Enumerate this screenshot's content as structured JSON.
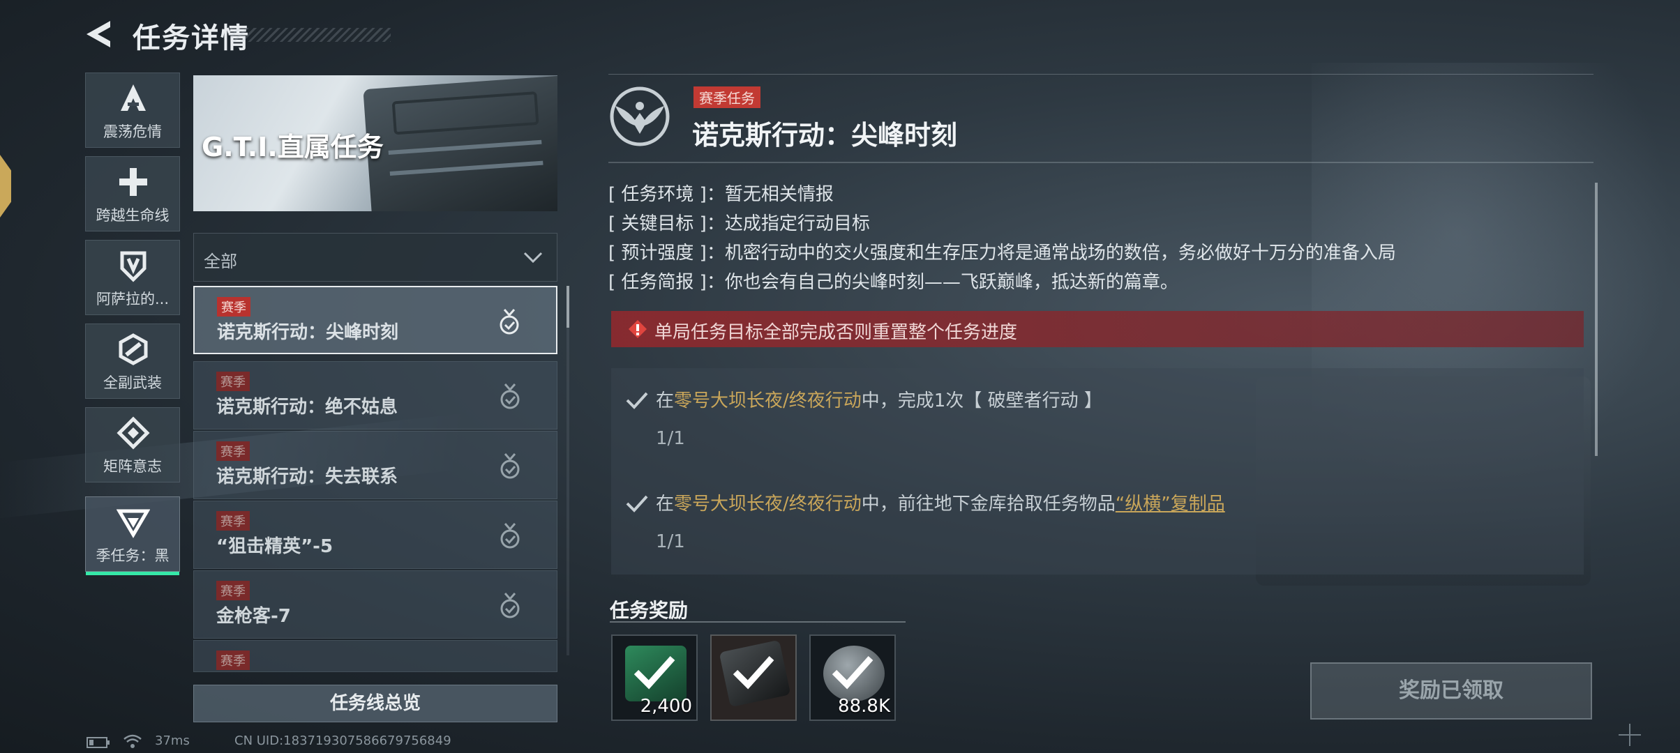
{
  "header": {
    "title": "任务详情"
  },
  "categories": [
    {
      "label": "震荡危情",
      "icon": "triangle-a-icon"
    },
    {
      "label": "跨越生命线",
      "icon": "cross-icon"
    },
    {
      "label": "阿萨拉的...",
      "icon": "shield-v-icon"
    },
    {
      "label": "全副武装",
      "icon": "hex-link-icon"
    },
    {
      "label": "矩阵意志",
      "icon": "diamond-arrows-icon"
    },
    {
      "label": "季任务：黑",
      "icon": "g-chevron-icon",
      "active": true
    }
  ],
  "banner": {
    "title": "G.T.I.直属任务"
  },
  "filter": {
    "value": "全部"
  },
  "missions": [
    {
      "tag": "赛季",
      "name": "诺克斯行动：尖峰时刻",
      "selected": true
    },
    {
      "tag": "赛季",
      "name": "诺克斯行动：绝不姑息"
    },
    {
      "tag": "赛季",
      "name": "诺克斯行动：失去联系"
    },
    {
      "tag": "赛季",
      "name": "“狙击精英”-5"
    },
    {
      "tag": "赛季",
      "name": "金枪客-7"
    },
    {
      "tag": "赛季",
      "name": ""
    }
  ],
  "overview_button": "任务线总览",
  "status_bar": {
    "ping": "37ms",
    "uid": "CN UID:183719307586679756849"
  },
  "detail": {
    "badge": "赛季任务",
    "title": "诺克斯行动：尖峰时刻",
    "info": [
      {
        "key": "[ 任务环境 ]",
        "value": "暂无相关情报"
      },
      {
        "key": "[ 关键目标 ]",
        "value": "达成指定行动目标"
      },
      {
        "key": "[ 预计强度 ]",
        "value": "机密行动中的交火强度和生存压力将是通常战场的数倍，务必做好十万分的准备入局"
      },
      {
        "key": "[ 任务简报 ]",
        "value": "你也会有自己的尖峰时刻——飞跃巅峰，抵达新的篇章。"
      }
    ],
    "warning": "单局任务目标全部完成否则重置整个任务进度",
    "objectives": [
      {
        "pre": "在",
        "map": "零号大坝长夜/终夜行动",
        "mid": "中，完成1次【 破壁者行动 】",
        "link": "",
        "progress": "1/1"
      },
      {
        "pre": "在",
        "map": "零号大坝长夜/终夜行动",
        "mid": "中，前往地下金库拾取任务物品",
        "link": "“纵横”复制品",
        "progress": "1/1"
      }
    ]
  },
  "rewards": {
    "title": "任务奖励",
    "items": [
      {
        "qty": "2,400",
        "icon": "green-token-icon"
      },
      {
        "qty": "",
        "icon": "card-case-icon"
      },
      {
        "qty": "88.8K",
        "icon": "silver-coin-icon"
      }
    ]
  },
  "claim_button": "奖励已领取",
  "colors": {
    "accent": "#36e8a8",
    "season_red": "#c23a33",
    "highlight_gold": "#c9a65a"
  }
}
